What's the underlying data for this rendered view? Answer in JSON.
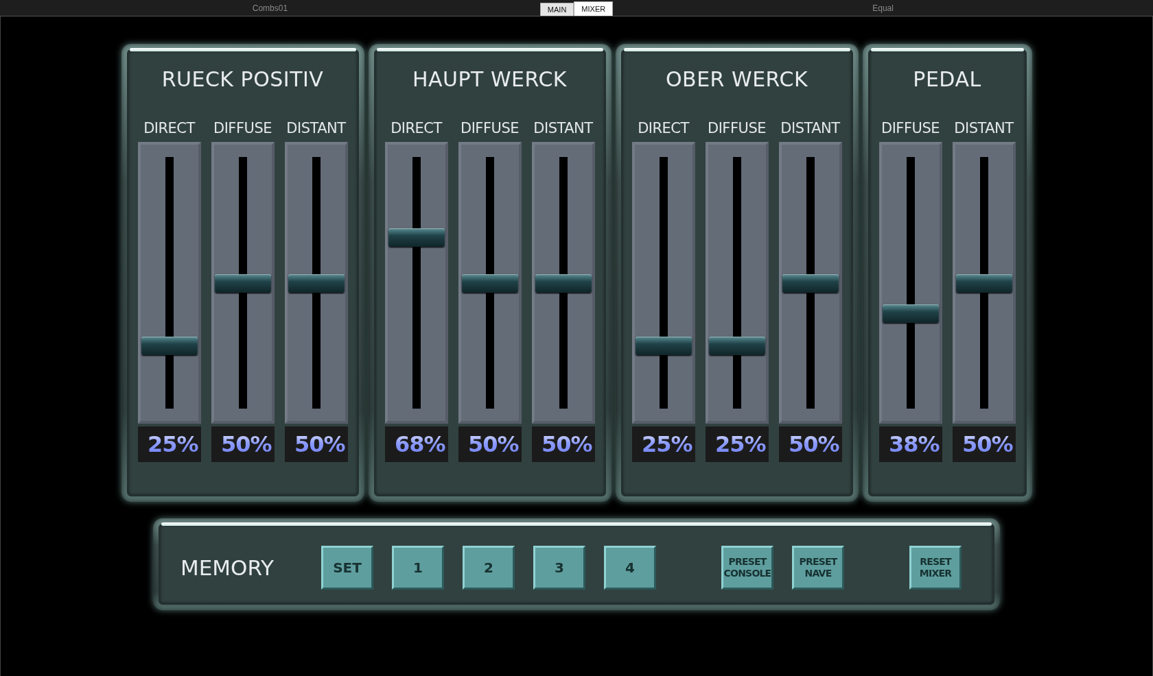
{
  "top_bar": {
    "left_label": "Combs01",
    "right_label": "Equal"
  },
  "tabs": [
    {
      "label": "MAIN",
      "selected": false
    },
    {
      "label": "MIXER",
      "selected": true
    }
  ],
  "divisions": [
    {
      "title": "RUECK POSITIV",
      "channels": [
        {
          "name": "DIRECT",
          "level": 0.25,
          "reading": "25%"
        },
        {
          "name": "DIFFUSE",
          "level": 0.5,
          "reading": "50%"
        },
        {
          "name": "DISTANT",
          "level": 0.5,
          "reading": "50%"
        }
      ]
    },
    {
      "title": "HAUPT WERCK",
      "channels": [
        {
          "name": "DIRECT",
          "level": 0.68,
          "reading": "68%"
        },
        {
          "name": "DIFFUSE",
          "level": 0.5,
          "reading": "50%"
        },
        {
          "name": "DISTANT",
          "level": 0.5,
          "reading": "50%"
        }
      ]
    },
    {
      "title": "OBER WERCK",
      "channels": [
        {
          "name": "DIRECT",
          "level": 0.25,
          "reading": "25%"
        },
        {
          "name": "DIFFUSE",
          "level": 0.25,
          "reading": "25%"
        },
        {
          "name": "DISTANT",
          "level": 0.5,
          "reading": "50%"
        }
      ]
    },
    {
      "title": "PEDAL",
      "channels": [
        {
          "name": "DIFFUSE",
          "level": 0.38,
          "reading": "38%"
        },
        {
          "name": "DISTANT",
          "level": 0.5,
          "reading": "50%"
        }
      ]
    }
  ],
  "memory": {
    "label": "MEMORY",
    "buttons": [
      {
        "label": "SET",
        "kind": "memory"
      },
      {
        "label": "1",
        "kind": "memory"
      },
      {
        "label": "2",
        "kind": "memory"
      },
      {
        "label": "3",
        "kind": "memory"
      },
      {
        "label": "4",
        "kind": "memory"
      },
      {
        "label": "PRESET CONSOLE",
        "kind": "preset"
      },
      {
        "label": "PRESET NAVE",
        "kind": "preset"
      },
      {
        "label": "RESET MIXER",
        "kind": "reset"
      }
    ]
  }
}
